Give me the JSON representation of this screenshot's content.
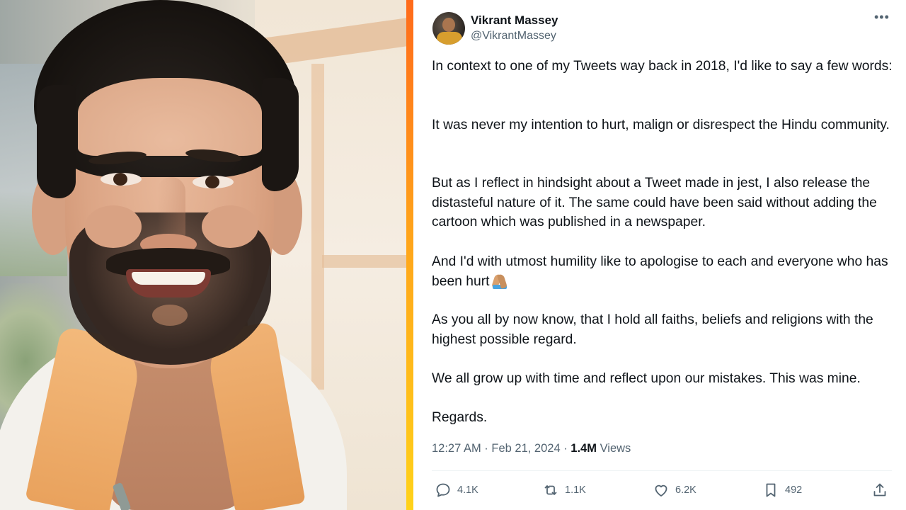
{
  "photo": {
    "alt": "Portrait photo of a smiling man with dark hair and a trimmed beard, wearing a white hoodie with an orange collar"
  },
  "tweet": {
    "author_name": "Vikrant Massey",
    "author_handle": "@VikrantMassey",
    "more_icon": "more-horizontal-icon",
    "paragraphs": [
      "In context to one of my Tweets way back in 2018, I'd like to say a few words:",
      "It was never my intention to hurt, malign or disrespect the Hindu community.",
      "But as I reflect in hindsight about a Tweet made in jest, I also release the distasteful nature of it. The same could have been said without adding the cartoon which was published in a newspaper.",
      "And I'd with utmost humility like to apologise to each and everyone who has been hurt",
      "As you all by now know, that I hold all faiths, beliefs and religions with the highest possible regard.",
      "We all grow up with time and reflect upon our mistakes. This was mine.",
      "Regards."
    ],
    "timestamp": "12:27 AM · Feb 21, 2024 · ",
    "views_count": "1.4M",
    "views_label": " Views",
    "actions": {
      "reply": {
        "icon": "reply-icon",
        "count": "4.1K"
      },
      "retweet": {
        "icon": "retweet-icon",
        "count": "1.1K"
      },
      "like": {
        "icon": "heart-icon",
        "count": "6.2K"
      },
      "bookmark": {
        "icon": "bookmark-icon",
        "count": "492"
      },
      "share": {
        "icon": "share-icon"
      }
    }
  },
  "colors": {
    "text_primary": "#0f1419",
    "text_secondary": "#536471",
    "divider_gradient": [
      "#ff6a1a",
      "#ffd21a"
    ]
  }
}
